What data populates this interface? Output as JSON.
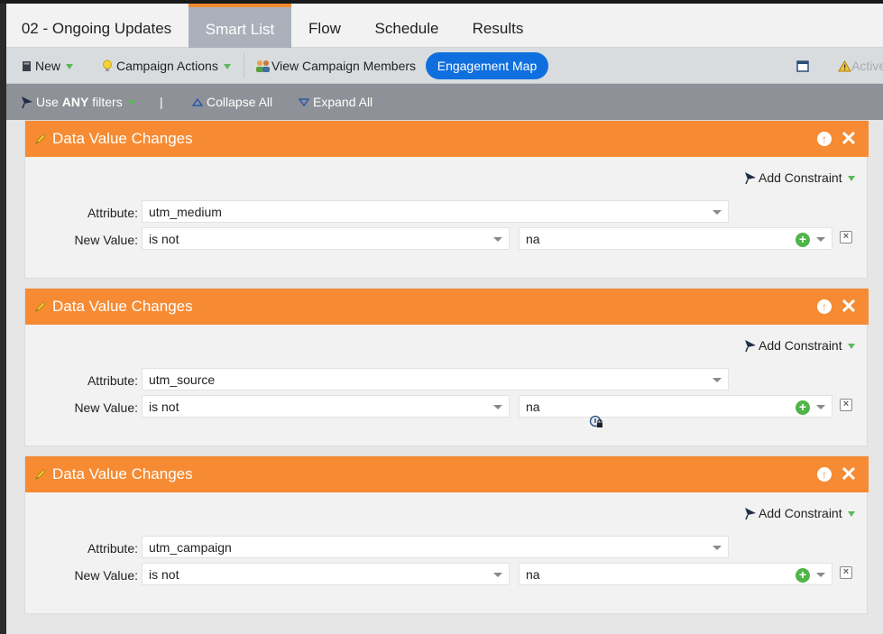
{
  "tabs": [
    {
      "label": "02 - Ongoing Updates",
      "active": false
    },
    {
      "label": "Smart List",
      "active": true
    },
    {
      "label": "Flow",
      "active": false
    },
    {
      "label": "Schedule",
      "active": false
    },
    {
      "label": "Results",
      "active": false
    }
  ],
  "toolbar": {
    "new_label": "New",
    "campaign_actions_label": "Campaign Actions",
    "view_members_label": "View Campaign Members",
    "engagement_map_label": "Engagement Map",
    "status_label": "Active"
  },
  "filter_bar": {
    "use_prefix": "Use ",
    "use_any": "ANY",
    "use_suffix": " filters",
    "separator": "|",
    "collapse_label": "Collapse All",
    "expand_label": "Expand All"
  },
  "colors": {
    "accent": "#f68b33",
    "button": "#0f6fde",
    "active_tab": "#aab1bb"
  },
  "filters": [
    {
      "title": "Data Value Changes",
      "add_constraint": "Add Constraint",
      "attribute_label": "Attribute:",
      "attribute_value": "utm_medium",
      "new_value_label": "New Value:",
      "operator": "is not",
      "value": "na"
    },
    {
      "title": "Data Value Changes",
      "add_constraint": "Add Constraint",
      "attribute_label": "Attribute:",
      "attribute_value": "utm_source",
      "new_value_label": "New Value:",
      "operator": "is not",
      "value": "na"
    },
    {
      "title": "Data Value Changes",
      "add_constraint": "Add Constraint",
      "attribute_label": "Attribute:",
      "attribute_value": "utm_campaign",
      "new_value_label": "New Value:",
      "operator": "is not",
      "value": "na"
    }
  ]
}
